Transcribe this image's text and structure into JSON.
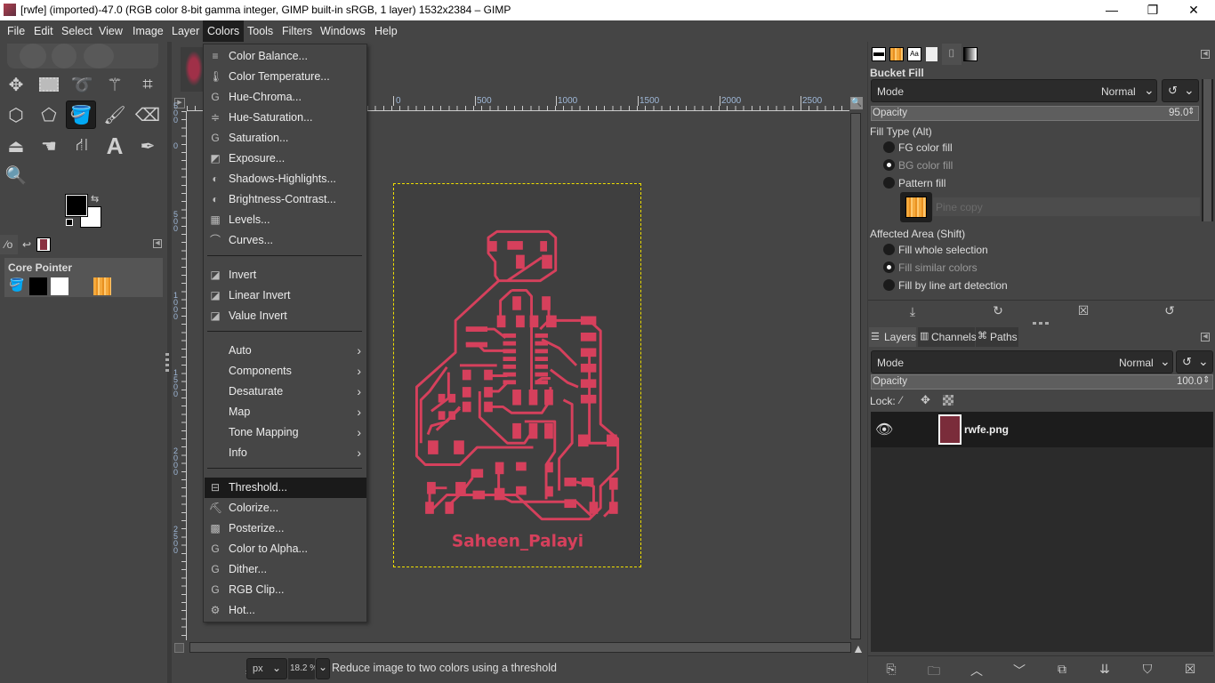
{
  "window": {
    "title": "[rwfe] (imported)-47.0 (RGB color 8-bit gamma integer, GIMP built-in sRGB, 1 layer) 1532x2384 – GIMP",
    "controls": {
      "minimize": "—",
      "maximize": "❐",
      "close": "✕"
    }
  },
  "menubar": [
    "File",
    "Edit",
    "Select",
    "View",
    "Image",
    "Layer",
    "Colors",
    "Tools",
    "Filters",
    "Windows",
    "Help"
  ],
  "active_menu": "Colors",
  "colors_menu": {
    "group1": [
      {
        "label": "Color Balance...",
        "icon": "≡"
      },
      {
        "label": "Color Temperature...",
        "icon": "🌡"
      },
      {
        "label": "Hue-Chroma...",
        "icon": "G"
      },
      {
        "label": "Hue-Saturation...",
        "icon": "≑"
      },
      {
        "label": "Saturation...",
        "icon": "G"
      },
      {
        "label": "Exposure...",
        "icon": "◩"
      },
      {
        "label": "Shadows-Highlights...",
        "icon": "◐"
      },
      {
        "label": "Brightness-Contrast...",
        "icon": "◐"
      },
      {
        "label": "Levels...",
        "icon": "▦"
      },
      {
        "label": "Curves...",
        "icon": "⌒"
      }
    ],
    "group2": [
      {
        "label": "Invert",
        "icon": "◪"
      },
      {
        "label": "Linear Invert",
        "icon": "◪"
      },
      {
        "label": "Value Invert",
        "icon": "◪"
      }
    ],
    "group3": [
      {
        "label": "Auto",
        "submenu": "›"
      },
      {
        "label": "Components",
        "submenu": "›"
      },
      {
        "label": "Desaturate",
        "submenu": "›"
      },
      {
        "label": "Map",
        "submenu": "›"
      },
      {
        "label": "Tone Mapping",
        "submenu": "›"
      },
      {
        "label": "Info",
        "submenu": "›"
      }
    ],
    "group4": [
      {
        "label": "Threshold...",
        "icon": "⊟",
        "highlighted": true
      },
      {
        "label": "Colorize...",
        "icon": "⛏"
      },
      {
        "label": "Posterize...",
        "icon": "▩"
      },
      {
        "label": "Color to Alpha...",
        "icon": "G"
      },
      {
        "label": "Dither...",
        "icon": "G"
      },
      {
        "label": "RGB Clip...",
        "icon": "G"
      },
      {
        "label": "Hot...",
        "icon": "⚙"
      }
    ]
  },
  "toolbox": {
    "tools": [
      "move-tool",
      "rect-select-tool",
      "free-select-tool",
      "fuzzy-select-tool",
      "crop-tool",
      "3d-transform-tool",
      "unified-transform-tool",
      "bucket-fill-tool",
      "paintbrush-tool",
      "eraser-tool",
      "clone-tool",
      "smudge-tool",
      "paths-tool",
      "text-tool",
      "color-picker-tool",
      "zoom-tool"
    ],
    "active_tool": "bucket-fill-tool",
    "fg_color": "#000000",
    "bg_color": "#ffffff",
    "device_status_title": "Core Pointer"
  },
  "rulers": {
    "h_ticks": [
      "0",
      "500",
      "1000",
      "1500",
      "2000",
      "2500"
    ],
    "v_ticks": [
      "500",
      "0",
      "500",
      "1000",
      "1500",
      "2000",
      "2500"
    ]
  },
  "canvas": {
    "pcb_text": "Saheen_Palayi",
    "trace_color": "#d6405c",
    "bg_color": "#454545"
  },
  "statusbar": {
    "unit": "px",
    "zoom": "18.2 %",
    "message": "Reduce image to two colors using a threshold"
  },
  "tool_options": {
    "title": "Bucket Fill",
    "mode_label": "Mode",
    "mode_value": "Normal",
    "opacity_label": "Opacity",
    "opacity_value": "95.0",
    "fill_type_label": "Fill Type  (Alt)",
    "fill_types": [
      {
        "label": "FG color fill",
        "selected": false
      },
      {
        "label": "BG color fill",
        "selected": true
      },
      {
        "label": "Pattern fill",
        "selected": false
      }
    ],
    "pattern_name": "Pine copy",
    "affected_area_label": "Affected Area  (Shift)",
    "affected_areas": [
      {
        "label": "Fill whole selection",
        "selected": false
      },
      {
        "label": "Fill similar colors",
        "selected": true
      },
      {
        "label": "Fill by line art detection",
        "selected": false
      }
    ]
  },
  "layers_panel": {
    "tabs": [
      "Layers",
      "Channels",
      "Paths"
    ],
    "mode_label": "Mode",
    "mode_value": "Normal",
    "opacity_label": "Opacity",
    "opacity_value": "100.0",
    "lock_label": "Lock:",
    "layers": [
      {
        "name": "rwfe.png",
        "visible": true
      }
    ]
  }
}
